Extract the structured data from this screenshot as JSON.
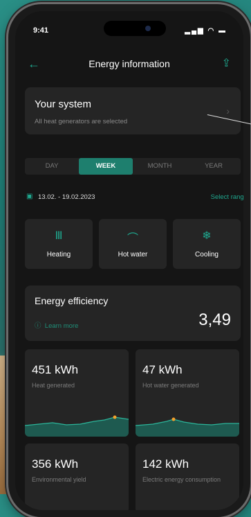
{
  "status": {
    "time": "9:41",
    "indicators": "signal-wifi-battery"
  },
  "nav": {
    "title": "Energy information",
    "back_icon": "arrow-left-icon",
    "share_icon": "share-icon"
  },
  "system": {
    "title": "Your system",
    "subtitle": "All heat generators are selected"
  },
  "period_tabs": [
    {
      "label": "DAY",
      "active": false
    },
    {
      "label": "WEEK",
      "active": true
    },
    {
      "label": "MONTH",
      "active": false
    },
    {
      "label": "YEAR",
      "active": false
    }
  ],
  "date_range": {
    "value": "13.02. - 19.02.2023",
    "select_label": "Select range"
  },
  "modes": [
    {
      "label": "Heating",
      "icon": "heating-radiator-icon"
    },
    {
      "label": "Hot water",
      "icon": "hot-water-tap-icon"
    },
    {
      "label": "Cooling",
      "icon": "snowflake-icon"
    }
  ],
  "efficiency": {
    "title": "Energy efficiency",
    "learn_more": "Learn more",
    "value": "3,49"
  },
  "stats": [
    {
      "value": "451 kWh",
      "label": "Heat generated"
    },
    {
      "value": "47 kWh",
      "label": "Hot water generated"
    },
    {
      "value": "356 kWh",
      "label": "Environmental yield"
    },
    {
      "value": "142 kWh",
      "label": "Electric energy consumption"
    }
  ],
  "colors": {
    "accent": "#1fa88f",
    "active_tab": "#1e7f6e",
    "card": "#252525",
    "screen": "#151515",
    "highlight": "#f2a12c"
  }
}
